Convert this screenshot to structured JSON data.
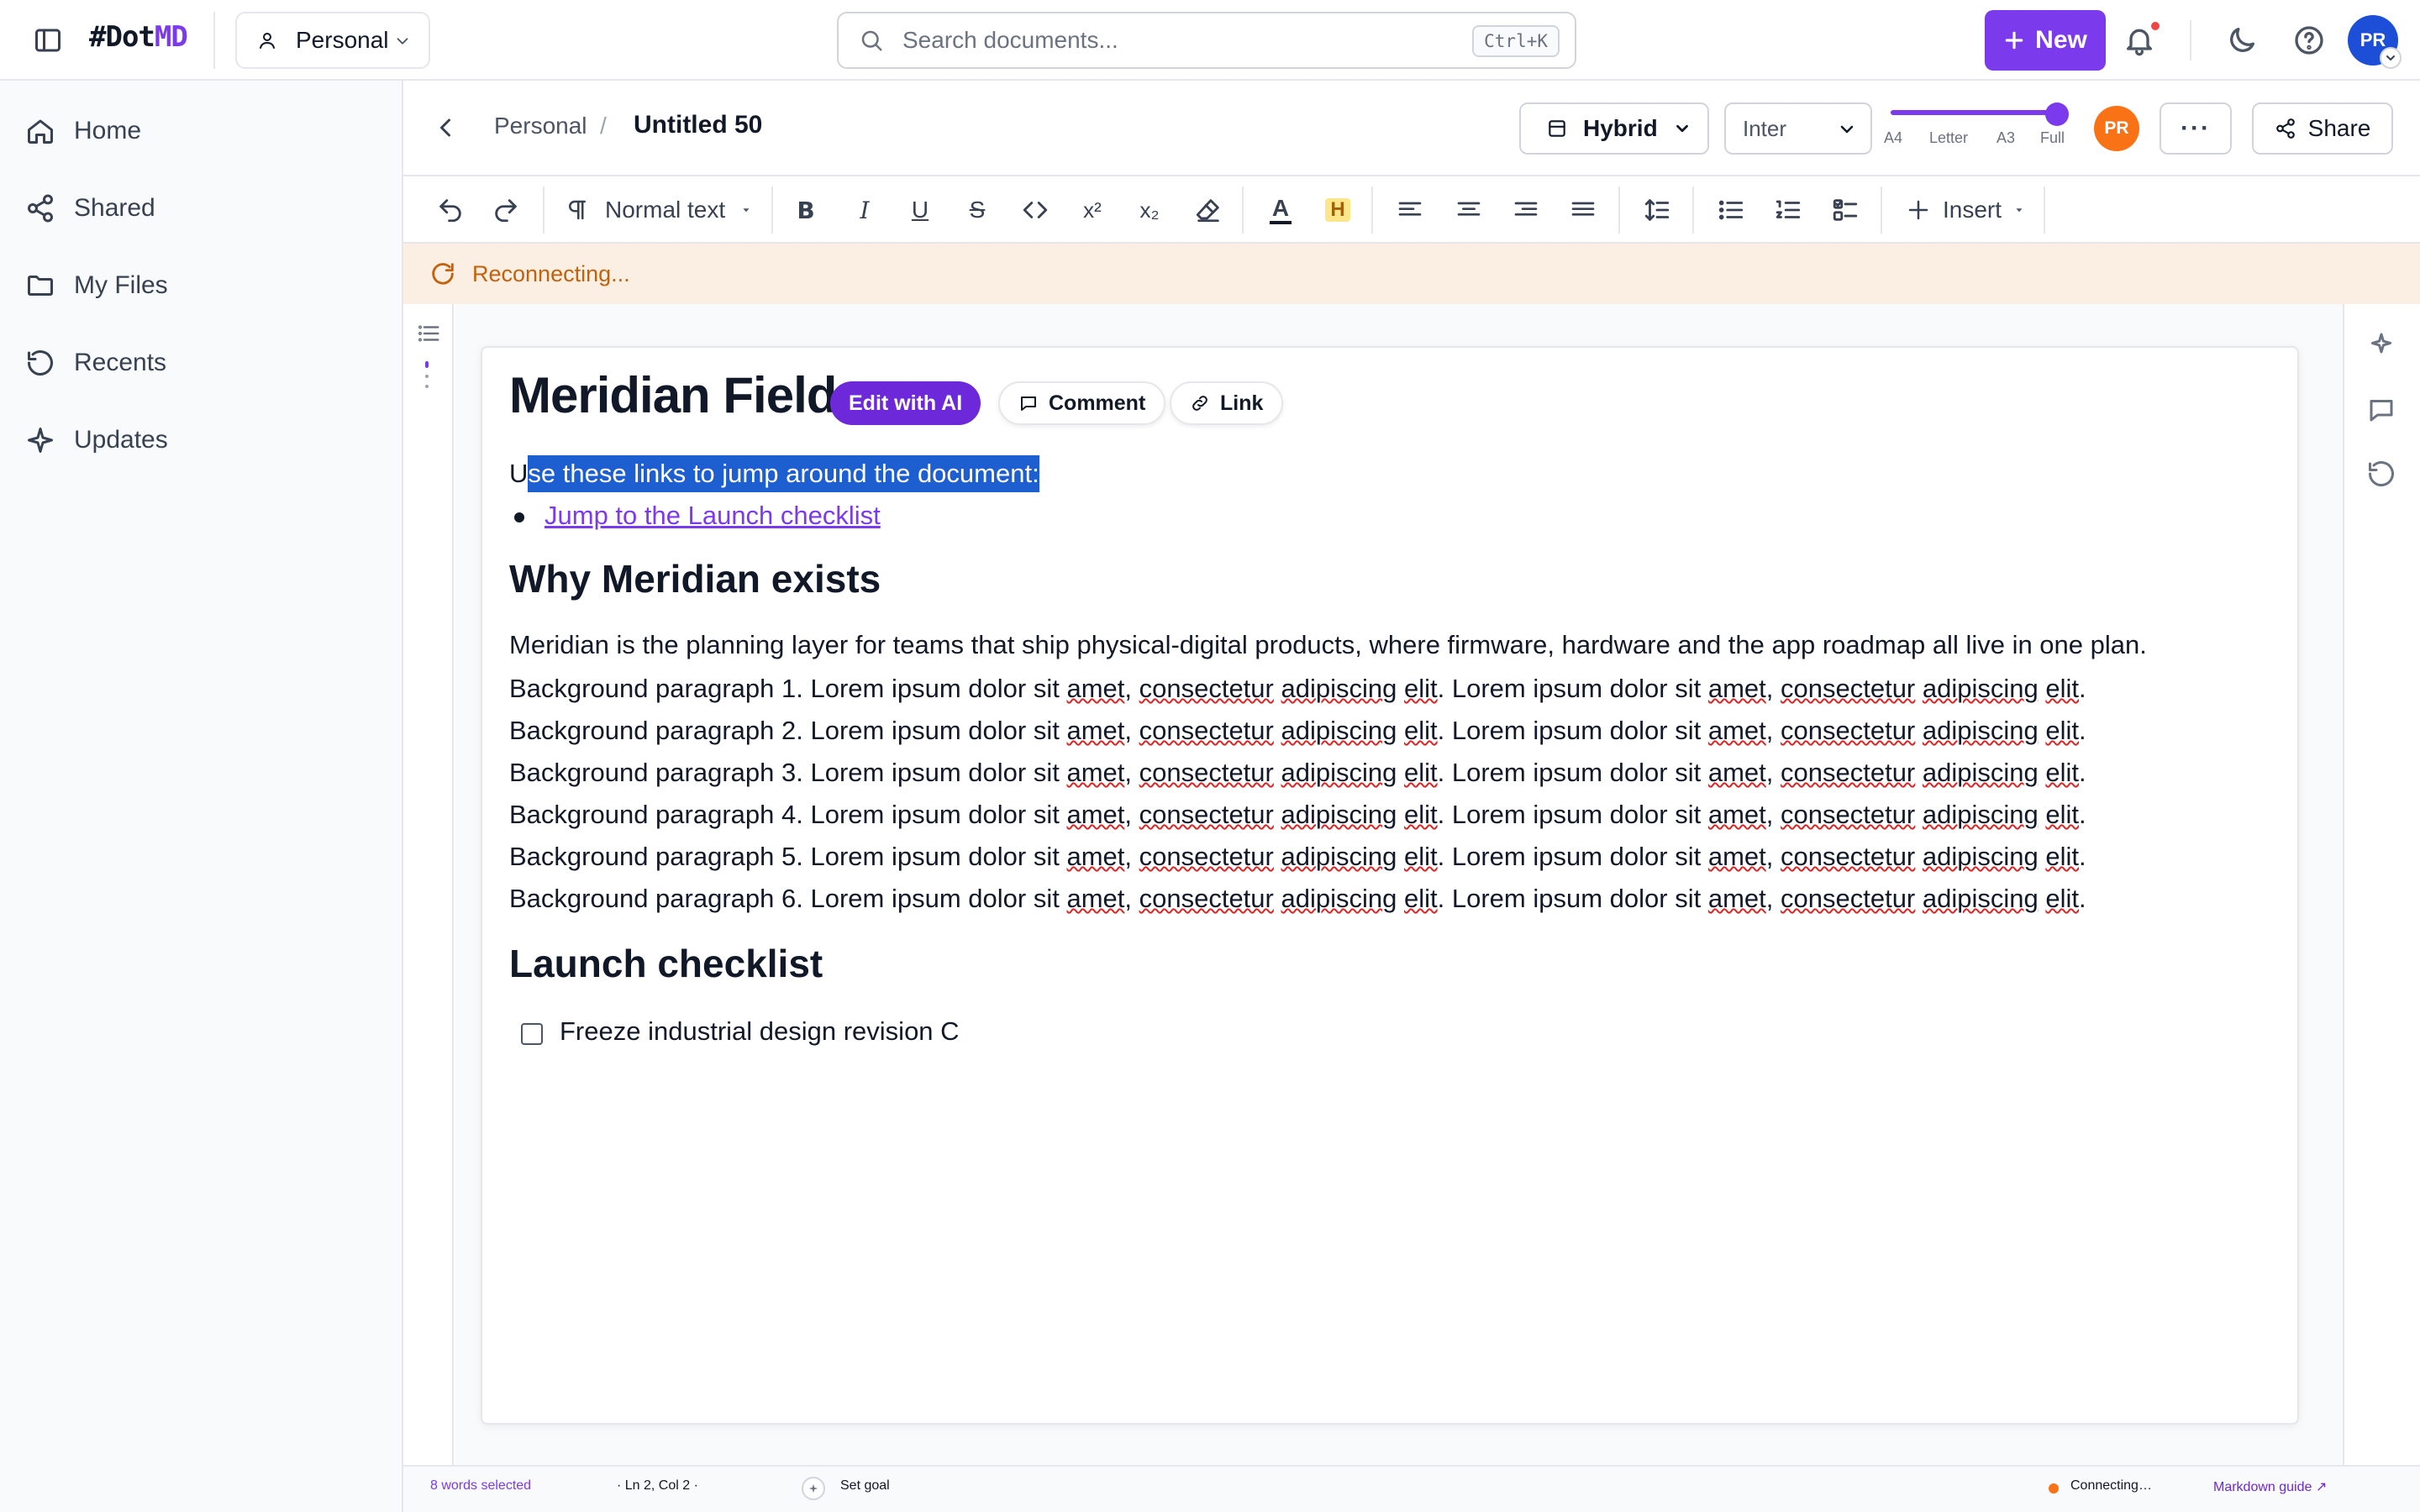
{
  "app": {
    "logo_hash": "#Dot",
    "logo_md": "MD",
    "workspace": "Personal",
    "search_placeholder": "Search documents...",
    "search_shortcut": "Ctrl+K",
    "new_label": "New",
    "avatar_initials": "PR",
    "brand_color": "#7c3aed"
  },
  "sidebar": {
    "items": [
      {
        "label": "Home",
        "icon": "home-icon"
      },
      {
        "label": "Shared",
        "icon": "share-icon"
      },
      {
        "label": "My Files",
        "icon": "folder-icon"
      },
      {
        "label": "Recents",
        "icon": "history-icon"
      },
      {
        "label": "Updates",
        "icon": "sparkle-icon"
      }
    ]
  },
  "doc_header": {
    "breadcrumb_parent": "Personal",
    "breadcrumb_sep": "/",
    "title": "Untitled 50",
    "view_mode": "Hybrid",
    "font": "Inter",
    "page_sizes": [
      "A4",
      "Letter",
      "A3",
      "Full"
    ],
    "page_size_selected": "Full",
    "collaborator_initials": "PR",
    "more_label": "···",
    "share_label": "Share"
  },
  "toolbar": {
    "block_type": "Normal text",
    "bold": "B",
    "italic": "I",
    "underline": "U",
    "strike": "S",
    "code": "‹›",
    "superscript": "x²",
    "subscript": "x₂",
    "text_color": "A",
    "highlight": "H",
    "insert_label": "Insert"
  },
  "banner": {
    "text": "Reconnecting...",
    "color": "#c2620c"
  },
  "document": {
    "title_visible": "Meridian Field",
    "toolbar_ai": "Edit with AI",
    "toolbar_comment": "Comment",
    "toolbar_link": "Link",
    "intro_first_char": "U",
    "intro_selected": "se these links to jump around the document:",
    "link_text": "Jump to the Launch checklist",
    "heading_why": "Why Meridian exists",
    "why_paragraph": "Meridian is the planning layer for teams that ship physical-digital products, where firmware, hardware and the app roadmap all live in one plan.",
    "background_paragraphs": [
      "Background paragraph 1.",
      "Background paragraph 2.",
      "Background paragraph 3.",
      "Background paragraph 4.",
      "Background paragraph 5.",
      "Background paragraph 6."
    ],
    "lorem_a": "Lorem ipsum dolor sit",
    "lorem_w1": "amet",
    "lorem_w2": "consectetur",
    "lorem_w3": "adipiscing",
    "lorem_w4": "elit",
    "heading_launch": "Launch checklist",
    "checklist": [
      {
        "label": "Freeze industrial design revision C",
        "checked": false
      }
    ]
  },
  "status": {
    "words_selected": "8 words selected",
    "position": "· Ln 2, Col 2 ·",
    "set_goal": "Set goal",
    "connection": "Connecting…",
    "markdown_guide": "Markdown guide ↗",
    "connection_color": "#f97316"
  }
}
